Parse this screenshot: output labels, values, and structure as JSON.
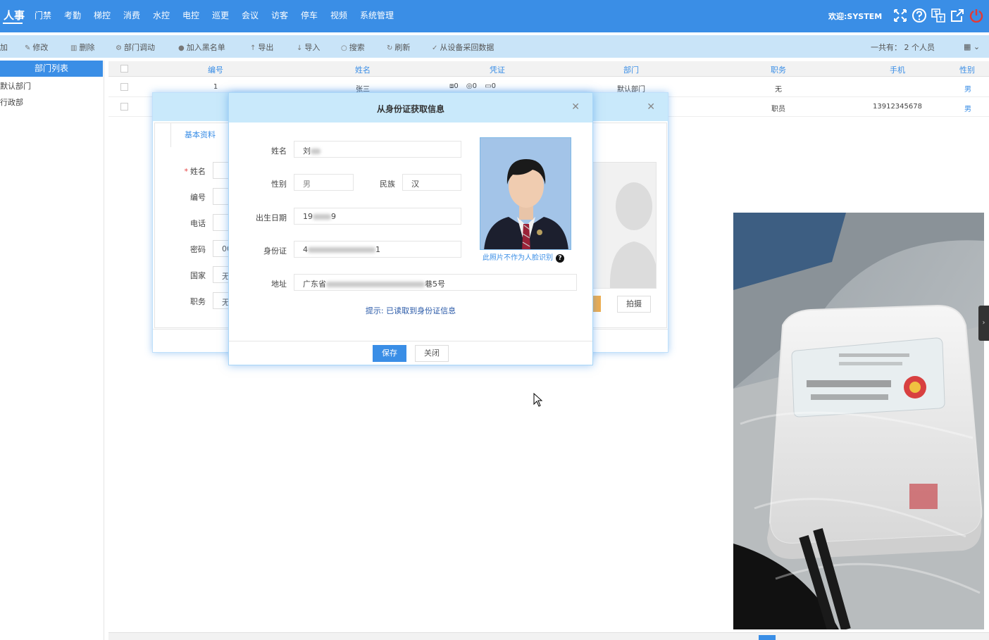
{
  "nav": {
    "items": [
      "人事",
      "门禁",
      "考勤",
      "梯控",
      "消费",
      "水控",
      "电控",
      "巡更",
      "会议",
      "访客",
      "停车",
      "视频",
      "系统管理"
    ],
    "welcome": "欢迎:SYSTEM",
    "icons": [
      "fullscreen-icon",
      "help-icon",
      "language-icon",
      "external-link-icon",
      "power-icon"
    ]
  },
  "toolbar": {
    "items": [
      "加",
      "修改",
      "删除",
      "部门调动",
      "加入黑名单",
      "导出",
      "导入",
      "搜索",
      "刷新",
      "从设备采回数据"
    ],
    "total": "一共有： 2 个人员"
  },
  "sidebar": {
    "header": "部门列表",
    "items": [
      "默认部门",
      "行政部"
    ]
  },
  "table": {
    "headers": [
      "编号",
      "姓名",
      "凭证",
      "部门",
      "职务",
      "手机",
      "性别"
    ],
    "rows": [
      {
        "number": "1",
        "name": "张三",
        "cred": [
          "0",
          "0",
          "0"
        ],
        "dept": "默认部门",
        "title": "无",
        "phone": "",
        "gender": "男"
      },
      {
        "number": "",
        "name": "",
        "cred": [],
        "dept": "",
        "title": "职员",
        "phone": "13912345678",
        "gender": "男"
      }
    ]
  },
  "back_dialog": {
    "tab": "基本资料",
    "labels": [
      "姓名",
      "编号",
      "电话",
      "密码",
      "国家",
      "职务"
    ],
    "values": [
      "",
      "",
      "",
      "00",
      "无",
      "无"
    ],
    "capture_button": "拍摄"
  },
  "front_dialog": {
    "title": "从身份证获取信息",
    "labels": {
      "name": "姓名",
      "gender": "性别",
      "ethnicity": "民族",
      "birth": "出生日期",
      "id": "身份证",
      "address": "地址"
    },
    "values": {
      "name_prefix": "刘",
      "gender": "男",
      "ethnicity": "汉",
      "birth_prefix": "19",
      "birth_suffix": "9",
      "id_prefix": "4",
      "id_suffix": "1",
      "address_prefix": "广东省",
      "address_suffix": "巷5号"
    },
    "photo_note": "此照片不作为人脸识别",
    "hint": "提示: 已读取到身份证信息",
    "save": "保存",
    "close": "关闭"
  },
  "colors": {
    "primary": "#3a8ee6",
    "toolbar_bg": "#c9e4f8",
    "dialog_title_bg": "#c9e9fb",
    "power_red": "#e53935"
  }
}
